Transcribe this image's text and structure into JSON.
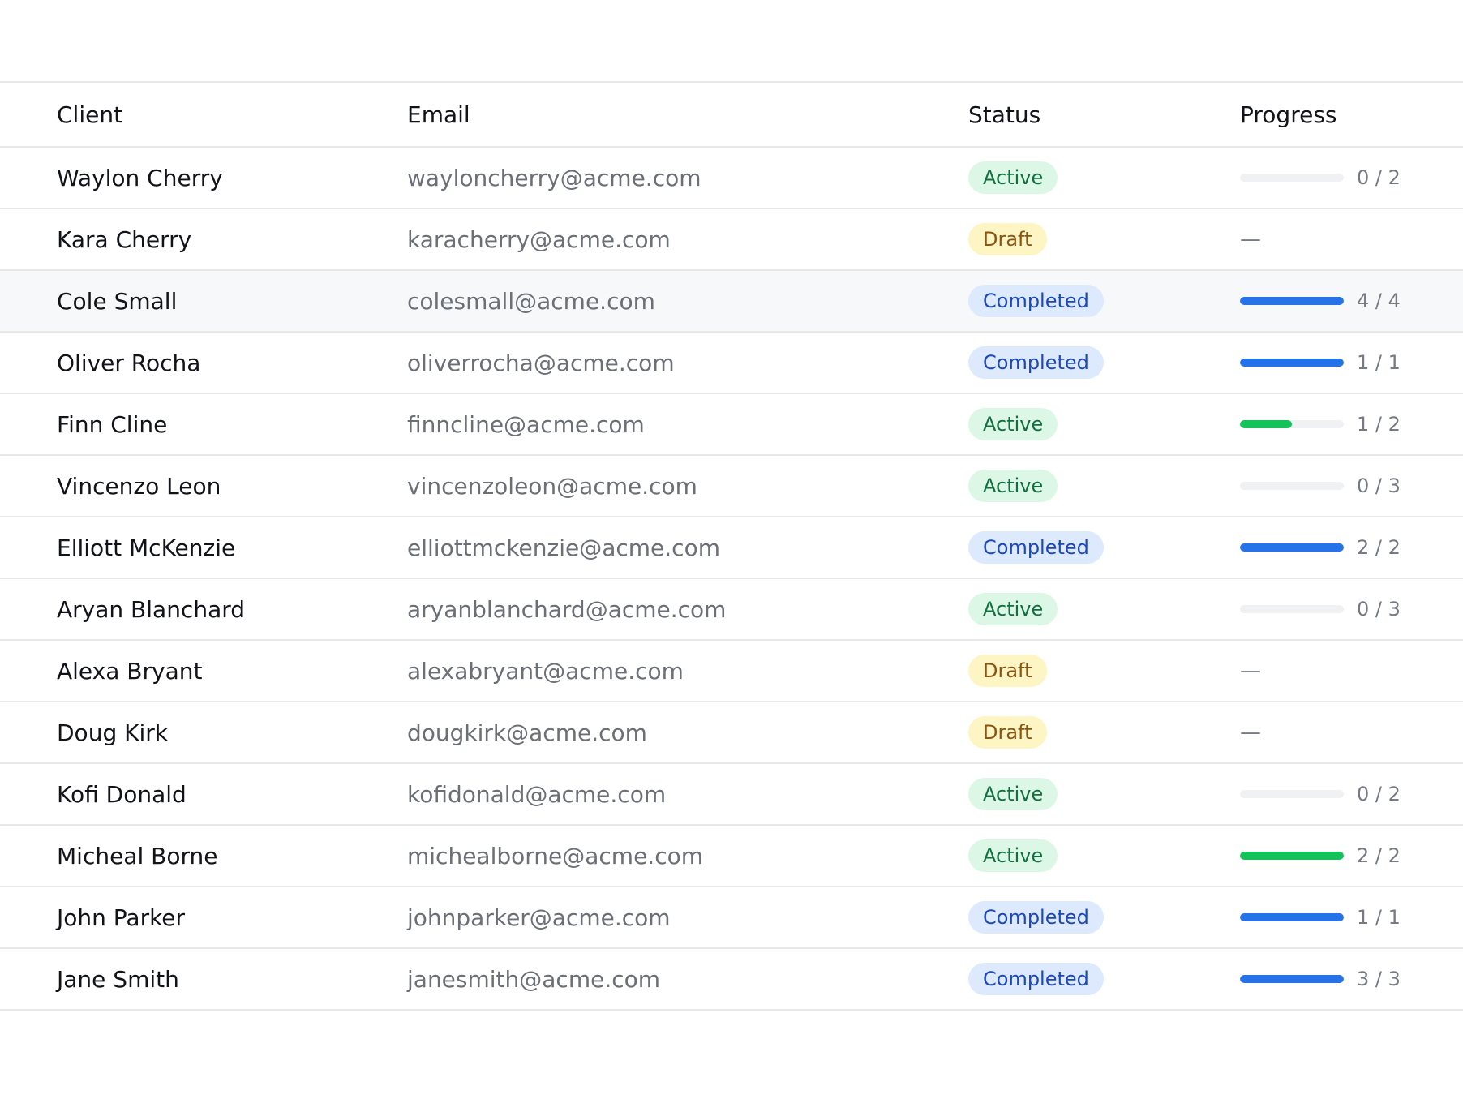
{
  "columns": {
    "client": "Client",
    "email": "Email",
    "status": "Status",
    "progress": "Progress"
  },
  "rows": [
    {
      "client": "Waylon Cherry",
      "email": "wayloncherry@acme.com",
      "status": "Active",
      "progress_label": "0 / 2",
      "progress_fraction": 0
    },
    {
      "client": "Kara Cherry",
      "email": "karacherry@acme.com",
      "status": "Draft",
      "progress_label": "—",
      "progress_fraction": null
    },
    {
      "client": "Cole Small",
      "email": "colesmall@acme.com",
      "status": "Completed",
      "progress_label": "4 / 4",
      "progress_fraction": 1
    },
    {
      "client": "Oliver Rocha",
      "email": "oliverrocha@acme.com",
      "status": "Completed",
      "progress_label": "1 / 1",
      "progress_fraction": 1
    },
    {
      "client": "Finn Cline",
      "email": "finncline@acme.com",
      "status": "Active",
      "progress_label": "1 / 2",
      "progress_fraction": 0.5
    },
    {
      "client": "Vincenzo Leon",
      "email": "vincenzoleon@acme.com",
      "status": "Active",
      "progress_label": "0 / 3",
      "progress_fraction": 0
    },
    {
      "client": "Elliott McKenzie",
      "email": "elliottmckenzie@acme.com",
      "status": "Completed",
      "progress_label": "2 / 2",
      "progress_fraction": 1
    },
    {
      "client": "Aryan Blanchard",
      "email": "aryanblanchard@acme.com",
      "status": "Active",
      "progress_label": "0 / 3",
      "progress_fraction": 0
    },
    {
      "client": "Alexa Bryant",
      "email": "alexabryant@acme.com",
      "status": "Draft",
      "progress_label": "—",
      "progress_fraction": null
    },
    {
      "client": "Doug Kirk",
      "email": "dougkirk@acme.com",
      "status": "Draft",
      "progress_label": "—",
      "progress_fraction": null
    },
    {
      "client": "Kofi Donald",
      "email": "kofidonald@acme.com",
      "status": "Active",
      "progress_label": "0 / 2",
      "progress_fraction": 0
    },
    {
      "client": "Micheal Borne",
      "email": "michealborne@acme.com",
      "status": "Active",
      "progress_label": "2 / 2",
      "progress_fraction": 1
    },
    {
      "client": "John Parker",
      "email": "johnparker@acme.com",
      "status": "Completed",
      "progress_label": "1 / 1",
      "progress_fraction": 1
    },
    {
      "client": "Jane Smith",
      "email": "janesmith@acme.com",
      "status": "Completed",
      "progress_label": "3 / 3",
      "progress_fraction": 1
    }
  ],
  "highlighted_row": 2,
  "colors": {
    "active_bg": "#ddf7e6",
    "active_text": "#12703f",
    "draft_bg": "#fdf5c4",
    "draft_text": "#8a5411",
    "completed_bg": "#dde9fd",
    "completed_text": "#1d48b8",
    "bar_blue": "#2672e8",
    "bar_green": "#15c15a",
    "bar_track": "#f0f1f2",
    "row_highlight": "#f7f8f9"
  }
}
